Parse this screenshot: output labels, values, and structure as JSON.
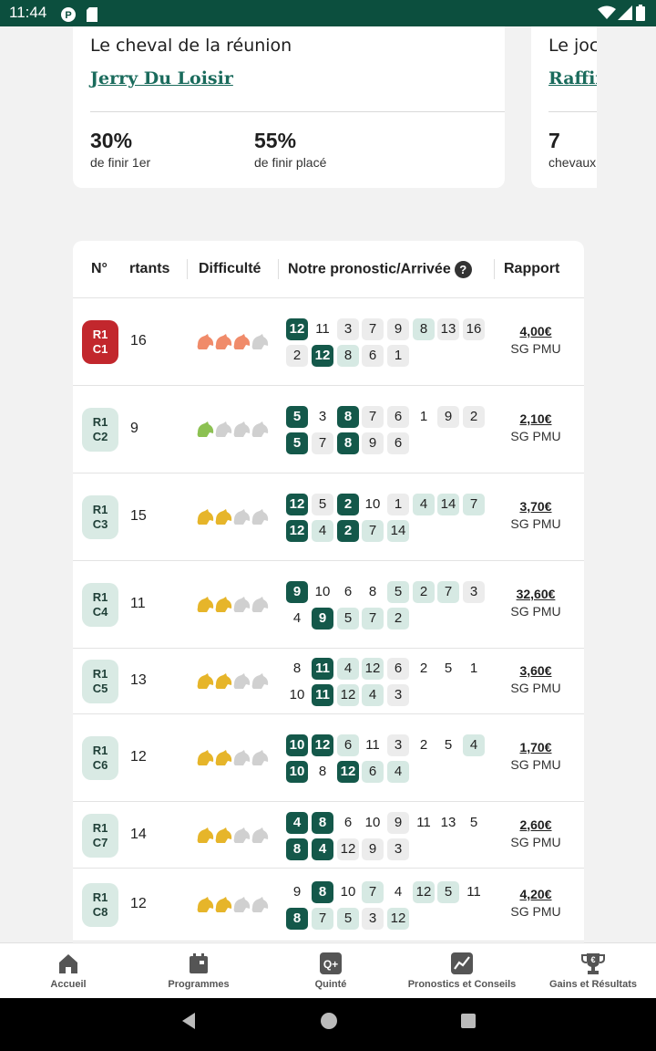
{
  "status_bar": {
    "time": "11:44"
  },
  "cards": [
    {
      "label": "Le cheval de la réunion",
      "name": "Jerry Du Loisir",
      "stats": [
        {
          "value": "30%",
          "caption": "de finir 1er"
        },
        {
          "value": "55%",
          "caption": "de finir placé"
        }
      ]
    },
    {
      "label": "Le joc",
      "name": "Raffir",
      "stats": [
        {
          "value": "7",
          "caption": "chevaux"
        }
      ]
    }
  ],
  "table": {
    "headers": {
      "num": "N°",
      "partants": "rtants",
      "difficulte": "Difficulté",
      "pronostic": "Notre pronostic/Arrivée",
      "help": "?",
      "rapport": "Rapport"
    },
    "rows": [
      {
        "r": "R1",
        "c": "C1",
        "partants": "16",
        "difficulty": 3,
        "diffcolor": "#f08b6a",
        "red": true,
        "prono": [
          [
            "12",
            "d"
          ],
          [
            "11",
            "w"
          ],
          [
            "3",
            "p"
          ],
          [
            "7",
            "p"
          ],
          [
            "9",
            "p"
          ],
          [
            "8",
            "l"
          ],
          [
            "13",
            "p"
          ],
          [
            "16",
            "p"
          ]
        ],
        "arrivee": [
          [
            "2",
            "p"
          ],
          [
            "12",
            "d"
          ],
          [
            "8",
            "l"
          ],
          [
            "6",
            "p"
          ],
          [
            "1",
            "p"
          ]
        ],
        "rapport": "4,00€",
        "rapport_sub": "SG PMU"
      },
      {
        "r": "R1",
        "c": "C2",
        "partants": "9",
        "difficulty": 1,
        "diffcolor": "#8cc152",
        "prono": [
          [
            "5",
            "d"
          ],
          [
            "3",
            "w"
          ],
          [
            "8",
            "d"
          ],
          [
            "7",
            "p"
          ],
          [
            "6",
            "p"
          ],
          [
            "1",
            "w"
          ],
          [
            "9",
            "p"
          ],
          [
            "2",
            "p"
          ]
        ],
        "arrivee": [
          [
            "5",
            "d"
          ],
          [
            "7",
            "p"
          ],
          [
            "8",
            "d"
          ],
          [
            "9",
            "p"
          ],
          [
            "6",
            "p"
          ]
        ],
        "rapport": "2,10€",
        "rapport_sub": "SG PMU"
      },
      {
        "r": "R1",
        "c": "C3",
        "partants": "15",
        "difficulty": 2,
        "diffcolor": "#e6b52a",
        "prono": [
          [
            "12",
            "d"
          ],
          [
            "5",
            "p"
          ],
          [
            "2",
            "d"
          ],
          [
            "10",
            "w"
          ],
          [
            "1",
            "p"
          ],
          [
            "4",
            "l"
          ],
          [
            "14",
            "l"
          ],
          [
            "7",
            "l"
          ]
        ],
        "arrivee": [
          [
            "12",
            "d"
          ],
          [
            "4",
            "l"
          ],
          [
            "2",
            "d"
          ],
          [
            "7",
            "l"
          ],
          [
            "14",
            "l"
          ]
        ],
        "rapport": "3,70€",
        "rapport_sub": "SG PMU"
      },
      {
        "r": "R1",
        "c": "C4",
        "partants": "11",
        "difficulty": 2,
        "diffcolor": "#e6b52a",
        "prono": [
          [
            "9",
            "d"
          ],
          [
            "10",
            "w"
          ],
          [
            "6",
            "w"
          ],
          [
            "8",
            "w"
          ],
          [
            "5",
            "l"
          ],
          [
            "2",
            "l"
          ],
          [
            "7",
            "l"
          ],
          [
            "3",
            "p"
          ]
        ],
        "arrivee": [
          [
            "4",
            "w"
          ],
          [
            "9",
            "d"
          ],
          [
            "5",
            "l"
          ],
          [
            "7",
            "l"
          ],
          [
            "2",
            "l"
          ]
        ],
        "rapport": "32,60€",
        "rapport_sub": "SG PMU"
      },
      {
        "r": "R1",
        "c": "C5",
        "partants": "13",
        "difficulty": 2,
        "diffcolor": "#e6b52a",
        "prono": [
          [
            "8",
            "w"
          ],
          [
            "11",
            "d"
          ],
          [
            "4",
            "l"
          ],
          [
            "12",
            "l"
          ],
          [
            "6",
            "p"
          ],
          [
            "2",
            "w"
          ],
          [
            "5",
            "w"
          ],
          [
            "1",
            "w"
          ]
        ],
        "arrivee": [
          [
            "10",
            "w"
          ],
          [
            "11",
            "d"
          ],
          [
            "12",
            "l"
          ],
          [
            "4",
            "l"
          ],
          [
            "3",
            "p"
          ]
        ],
        "rapport": "3,60€",
        "rapport_sub": "SG PMU"
      },
      {
        "r": "R1",
        "c": "C6",
        "partants": "12",
        "difficulty": 2,
        "diffcolor": "#e6b52a",
        "prono": [
          [
            "10",
            "d"
          ],
          [
            "12",
            "d"
          ],
          [
            "6",
            "l"
          ],
          [
            "11",
            "w"
          ],
          [
            "3",
            "p"
          ],
          [
            "2",
            "w"
          ],
          [
            "5",
            "w"
          ],
          [
            "4",
            "l"
          ]
        ],
        "arrivee": [
          [
            "10",
            "d"
          ],
          [
            "8",
            "w"
          ],
          [
            "12",
            "d"
          ],
          [
            "6",
            "l"
          ],
          [
            "4",
            "l"
          ]
        ],
        "rapport": "1,70€",
        "rapport_sub": "SG PMU"
      },
      {
        "r": "R1",
        "c": "C7",
        "partants": "14",
        "difficulty": 2,
        "diffcolor": "#e6b52a",
        "prono": [
          [
            "4",
            "d"
          ],
          [
            "8",
            "d"
          ],
          [
            "6",
            "w"
          ],
          [
            "10",
            "w"
          ],
          [
            "9",
            "p"
          ],
          [
            "11",
            "w"
          ],
          [
            "13",
            "w"
          ],
          [
            "5",
            "w"
          ]
        ],
        "arrivee": [
          [
            "8",
            "d"
          ],
          [
            "4",
            "d"
          ],
          [
            "12",
            "p"
          ],
          [
            "9",
            "p"
          ],
          [
            "3",
            "p"
          ]
        ],
        "rapport": "2,60€",
        "rapport_sub": "SG PMU"
      },
      {
        "r": "R1",
        "c": "C8",
        "partants": "12",
        "difficulty": 2,
        "diffcolor": "#e6b52a",
        "prono": [
          [
            "9",
            "w"
          ],
          [
            "8",
            "d"
          ],
          [
            "10",
            "w"
          ],
          [
            "7",
            "l"
          ],
          [
            "4",
            "w"
          ],
          [
            "12",
            "l"
          ],
          [
            "5",
            "l"
          ],
          [
            "11",
            "w"
          ]
        ],
        "arrivee": [
          [
            "8",
            "d"
          ],
          [
            "7",
            "l"
          ],
          [
            "5",
            "l"
          ],
          [
            "3",
            "p"
          ],
          [
            "12",
            "l"
          ]
        ],
        "rapport": "4,20€",
        "rapport_sub": "SG PMU"
      }
    ]
  },
  "nav": [
    {
      "label": "Accueil",
      "icon": "home-icon"
    },
    {
      "label": "Programmes",
      "icon": "calendar-icon"
    },
    {
      "label": "Quinté",
      "icon": "quinte-icon"
    },
    {
      "label": "Pronostics et Conseils",
      "icon": "chart-icon"
    },
    {
      "label": "Gains et Résultats",
      "icon": "trophy-icon"
    }
  ],
  "colors": {
    "primary": "#0c4f3e",
    "accent": "#1a6b5c",
    "chip_light": "#d6e9e3",
    "chip_dark": "#14584a",
    "red_badge": "#c2272d"
  }
}
